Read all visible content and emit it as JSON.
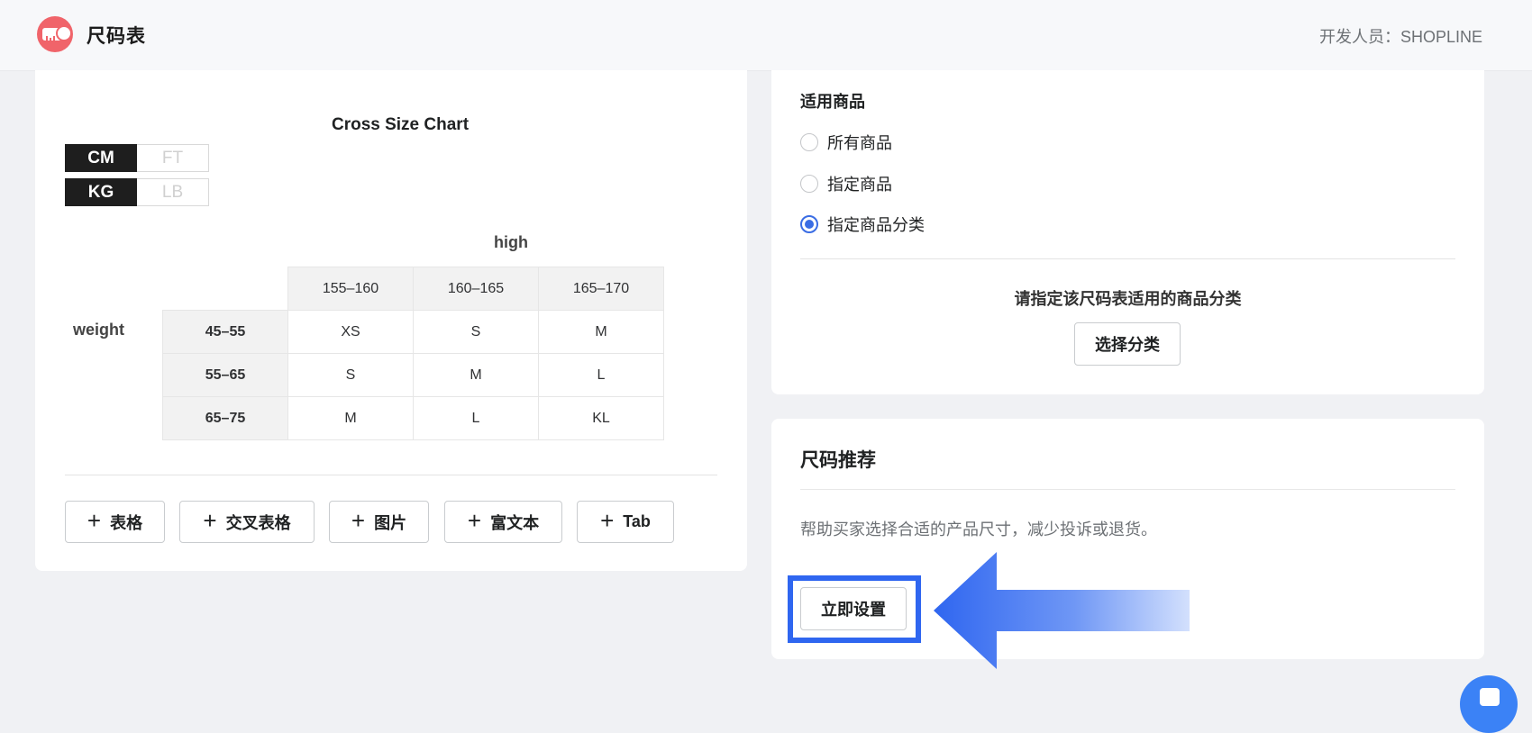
{
  "header": {
    "app_title": "尺码表",
    "developer": "开发人员：SHOPLINE"
  },
  "size_chart": {
    "title": "Cross Size Chart",
    "length_units": [
      "CM",
      "FT"
    ],
    "length_selected": "CM",
    "weight_units": [
      "KG",
      "LB"
    ],
    "weight_selected": "KG",
    "column_axis_label": "high",
    "row_axis_label": "weight",
    "columns": [
      "155–160",
      "160–165",
      "165–170"
    ],
    "rows": [
      {
        "label": "45–55",
        "cells": [
          "XS",
          "S",
          "M"
        ]
      },
      {
        "label": "55–65",
        "cells": [
          "S",
          "M",
          "L"
        ]
      },
      {
        "label": "65–75",
        "cells": [
          "M",
          "L",
          "KL"
        ]
      }
    ]
  },
  "add_buttons": [
    {
      "plus": "+",
      "label": "表格"
    },
    {
      "plus": "+",
      "label": "交叉表格"
    },
    {
      "plus": "+",
      "label": "图片"
    },
    {
      "plus": "+",
      "label": "富文本"
    },
    {
      "plus": "+",
      "label": "Tab"
    }
  ],
  "applicable": {
    "label": "适用商品",
    "options": [
      "所有商品",
      "指定商品",
      "指定商品分类"
    ],
    "selected_index": 2,
    "prompt": "请指定该尺码表适用的商品分类",
    "select_button": "选择分类"
  },
  "recommend": {
    "title": "尺码推荐",
    "description": "帮助买家选择合适的产品尺寸，减少投诉或退货。",
    "setup_button": "立即设置"
  },
  "colors": {
    "accent": "#3a6de4",
    "highlight": "#2f66f0",
    "logo": "#f0646a"
  },
  "icons": {
    "logo": "measuring-tape-icon",
    "plus": "plus-icon",
    "pointer": "arrow-left-icon",
    "chat": "chat-icon"
  }
}
